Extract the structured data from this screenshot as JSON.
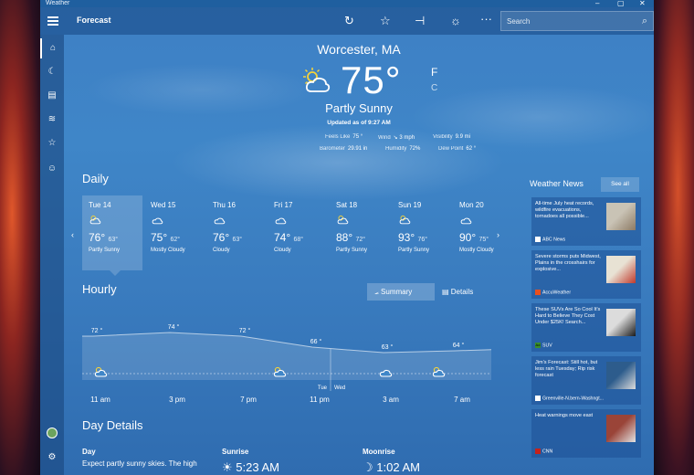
{
  "window": {
    "title": "Weather"
  },
  "toolbar": {
    "app_title": "Forecast",
    "search_placeholder": "Search"
  },
  "current": {
    "location": "Worcester, MA",
    "temperature": "75",
    "degree": "°",
    "unit_f": "F",
    "unit_c": "C",
    "condition": "Partly Sunny",
    "updated": "Updated as of 9:27 AM",
    "feels_like_label": "Feels Like",
    "feels_like": "75 °",
    "wind_label": "Wind",
    "wind": "↘ 3 mph",
    "visibility_label": "Visibility",
    "visibility": "9.9 mi",
    "barometer_label": "Barometer",
    "barometer": "29.91 in",
    "humidity_label": "Humidity",
    "humidity": "72%",
    "dewpoint_label": "Dew Point",
    "dewpoint": "62 °"
  },
  "daily": {
    "title": "Daily",
    "days": [
      {
        "name": "Tue 14",
        "hi": "76°",
        "lo": "63°",
        "cond": "Partly Sunny",
        "icon": "partly-sunny-icon"
      },
      {
        "name": "Wed 15",
        "hi": "75°",
        "lo": "62°",
        "cond": "Mostly Cloudy",
        "icon": "mostly-cloudy-icon"
      },
      {
        "name": "Thu 16",
        "hi": "76°",
        "lo": "63°",
        "cond": "Cloudy",
        "icon": "cloudy-icon"
      },
      {
        "name": "Fri 17",
        "hi": "74°",
        "lo": "68°",
        "cond": "Cloudy",
        "icon": "cloudy-icon"
      },
      {
        "name": "Sat 18",
        "hi": "88°",
        "lo": "72°",
        "cond": "Partly Sunny",
        "icon": "partly-sunny-icon"
      },
      {
        "name": "Sun 19",
        "hi": "93°",
        "lo": "76°",
        "cond": "Partly Sunny",
        "icon": "partly-sunny-icon"
      },
      {
        "name": "Mon 20",
        "hi": "90°",
        "lo": "75°",
        "cond": "Mostly Cloudy",
        "icon": "mostly-cloudy-icon"
      }
    ]
  },
  "hourly": {
    "title": "Hourly",
    "summary_label": "Summary",
    "details_label": "Details",
    "day_left": "Tue",
    "day_right": "Wed",
    "time_labels": [
      "11 am",
      "3 pm",
      "7 pm",
      "11 pm",
      "3 am",
      "7 am"
    ],
    "temps": [
      {
        "label": "72 °",
        "value": 72
      },
      {
        "label": "74 °",
        "value": 74
      },
      {
        "label": "72 °",
        "value": 72
      },
      {
        "label": "66 °",
        "value": 66
      },
      {
        "label": "63 °",
        "value": 63
      },
      {
        "label": "64 °",
        "value": 64
      }
    ]
  },
  "day_details": {
    "title": "Day Details",
    "day_label": "Day",
    "day_text": "Expect partly sunny skies. The high",
    "sunrise_label": "Sunrise",
    "sunrise": "5:23 AM",
    "moonrise_label": "Moonrise",
    "moonrise": "1:02 AM"
  },
  "news": {
    "title": "Weather News",
    "see_all": "See all",
    "items": [
      {
        "title": "All-time July heat records, wildfire evacuations, tornadoes all possible...",
        "source": "ABC News",
        "icon": "abc-news-logo-icon"
      },
      {
        "title": "Severe storms puts Midwest, Plains in the crosshairs for explosive...",
        "source": "AccuWeather",
        "icon": "accuweather-logo-icon"
      },
      {
        "title": "These SUVs Are So Cool It's Hard to Believe They Cost Under $25K! Search...",
        "source": "SUV",
        "badge": "Ad",
        "icon": "ad-badge-icon"
      },
      {
        "title": "Jim's Forecast: Still hot, but less rain Tuesday; Rip risk forecast",
        "source": "Greenville-N.bern-Washngt...",
        "icon": "local-news-logo-icon"
      },
      {
        "title": "Heat warnings move east",
        "source": "CNN",
        "icon": "cnn-logo-icon"
      }
    ]
  },
  "colors": {
    "window_blue": "#3e7fc4",
    "toolbar_blue": "#1f5f9f",
    "card_blue": "#1e5096"
  }
}
